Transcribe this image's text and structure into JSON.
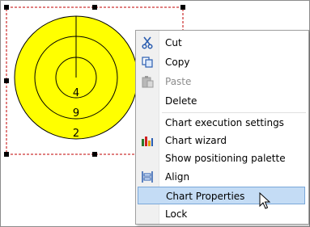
{
  "chart": {
    "ring_labels": [
      "4",
      "9",
      "2"
    ],
    "fill_color": "#ffff00",
    "selection_color": "#c00000"
  },
  "context_menu": {
    "items": [
      {
        "label": "Cut",
        "icon": "scissors-icon"
      },
      {
        "label": "Copy",
        "icon": "copy-icon"
      },
      {
        "label": "Paste",
        "icon": "paste-icon",
        "disabled": true
      },
      {
        "label": "Delete"
      },
      {
        "label": "Chart execution settings"
      },
      {
        "label": "Chart wizard",
        "icon": "chart-wizard-icon"
      },
      {
        "label": "Show positioning palette"
      },
      {
        "label": "Align",
        "icon": "align-icon"
      },
      {
        "label": "Chart Properties",
        "highlighted": true
      },
      {
        "label": "Lock"
      }
    ],
    "highlight_color": "#c4dcf5"
  }
}
